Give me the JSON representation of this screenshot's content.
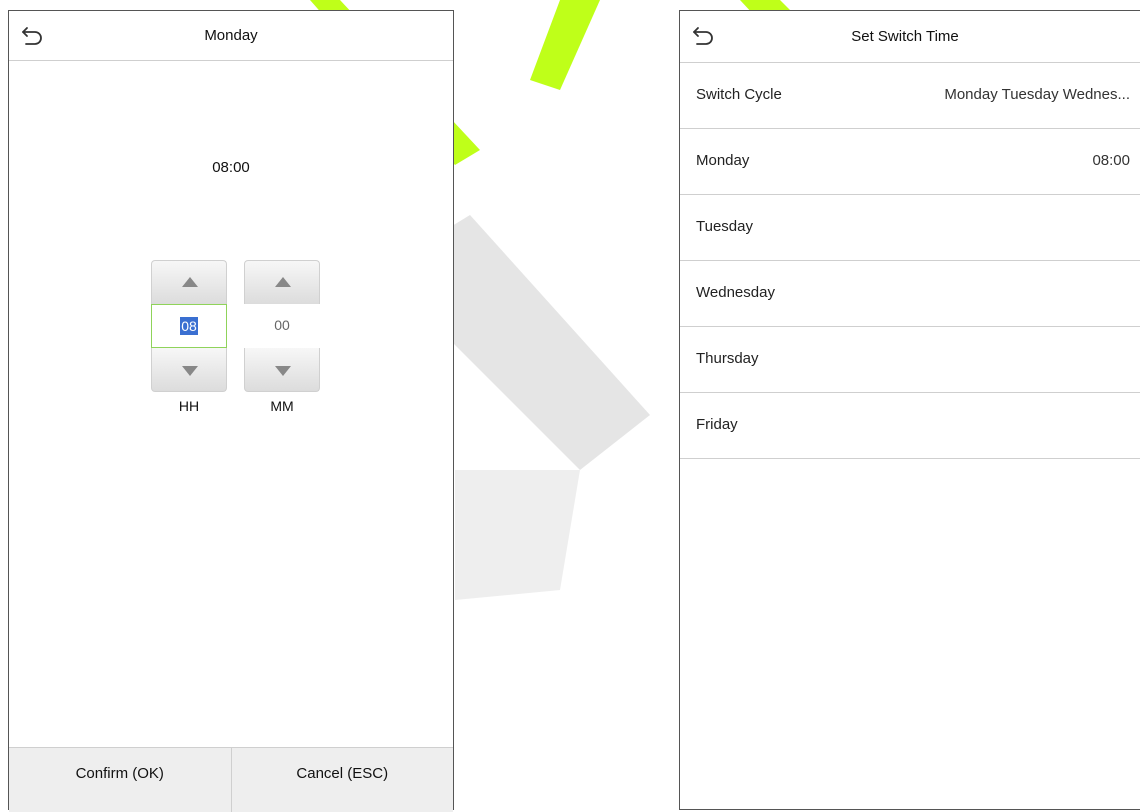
{
  "watermark": {
    "color_green": "#b8ff00",
    "color_gray": "#dedede"
  },
  "left_screen": {
    "back_icon": "back-arrow-icon",
    "title": "Monday",
    "time_display": "08:00",
    "hour": {
      "value": "08",
      "label": "HH"
    },
    "minute": {
      "value": "00",
      "label": "MM"
    },
    "confirm_label": "Confirm (OK)",
    "cancel_label": "Cancel (ESC)"
  },
  "right_screen": {
    "back_icon": "back-arrow-icon",
    "title": "Set Switch Time",
    "rows": [
      {
        "label": "Switch Cycle",
        "value": "Monday Tuesday Wednes..."
      },
      {
        "label": "Monday",
        "value": "08:00"
      },
      {
        "label": "Tuesday",
        "value": ""
      },
      {
        "label": "Wednesday",
        "value": ""
      },
      {
        "label": "Thursday",
        "value": ""
      },
      {
        "label": "Friday",
        "value": ""
      }
    ]
  },
  "colors": {
    "focus_border": "#8fd35a",
    "selection": "#3a6fd1",
    "footer_bg": "#eeeeee"
  }
}
